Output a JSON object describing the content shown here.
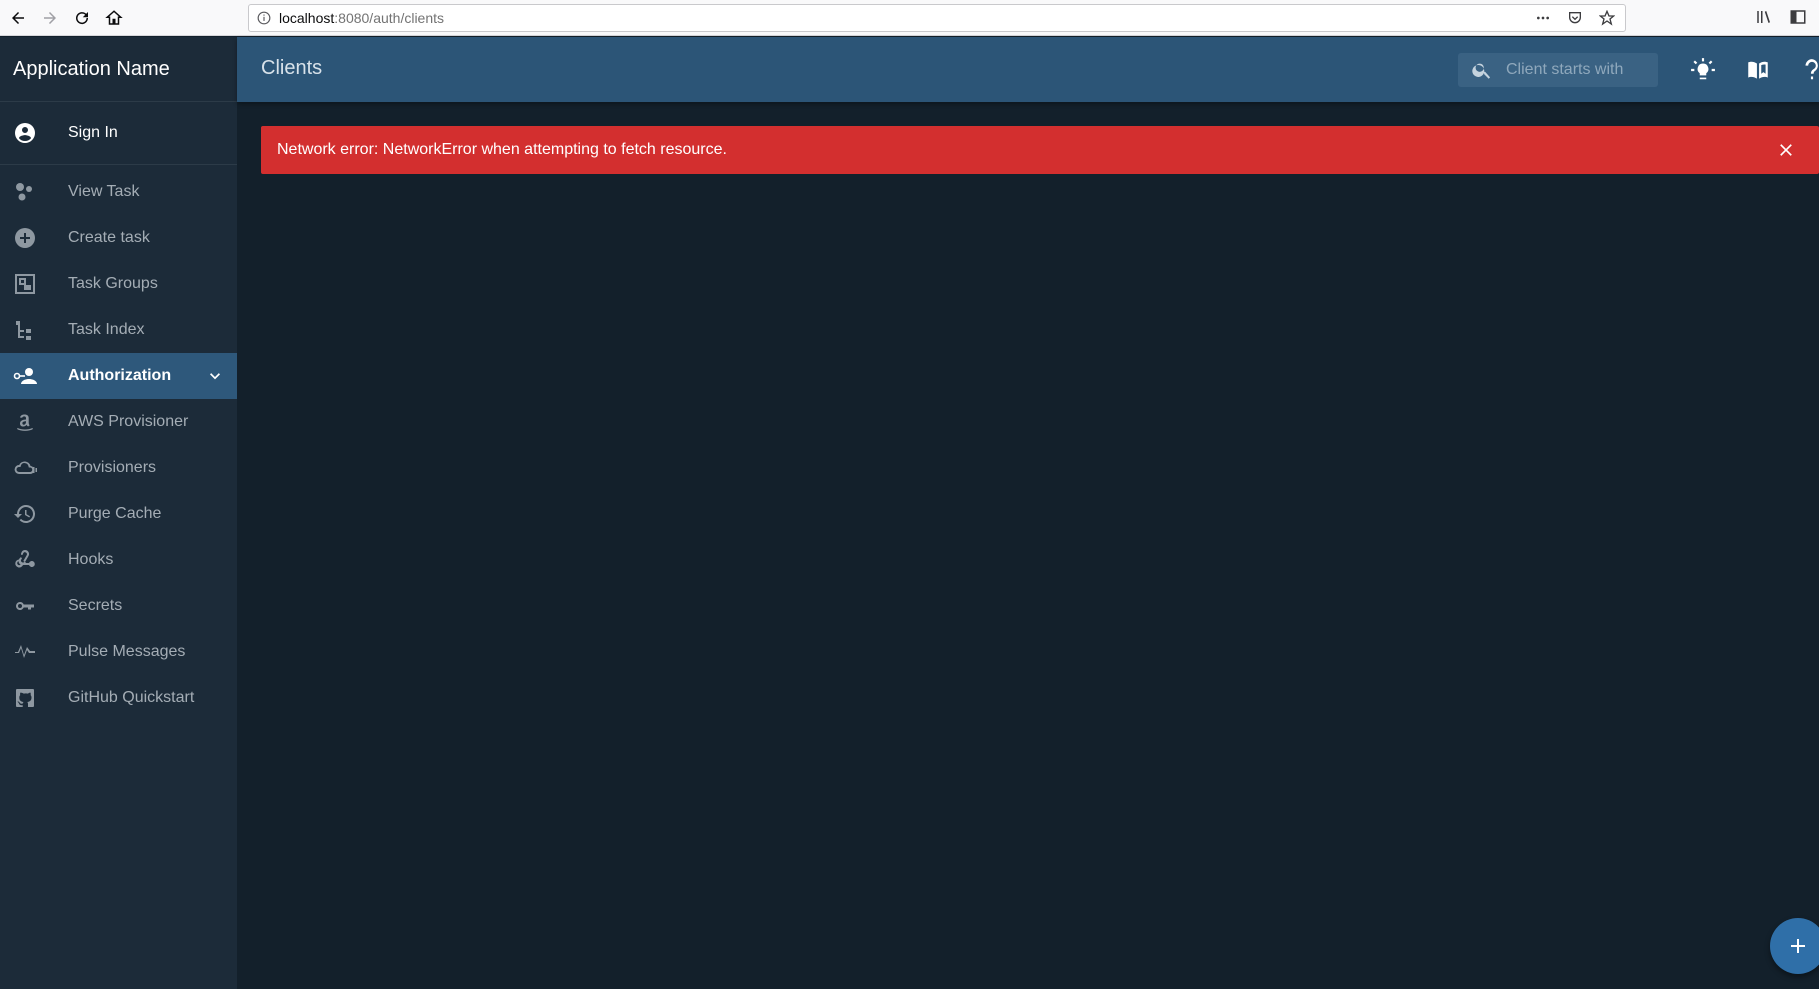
{
  "browser": {
    "url_host": "localhost",
    "url_rest": ":8080/auth/clients"
  },
  "sidebar": {
    "app_name": "Application Name",
    "sign_in": {
      "label": "Sign In",
      "icon": "account-circle-icon"
    },
    "items": [
      {
        "label": "View Task",
        "icon": "task-view-icon"
      },
      {
        "label": "Create task",
        "icon": "plus-circle-icon"
      },
      {
        "label": "Task Groups",
        "icon": "task-groups-icon"
      },
      {
        "label": "Task Index",
        "icon": "file-tree-icon"
      },
      {
        "label": "Authorization",
        "icon": "account-key-icon",
        "active": true
      },
      {
        "label": "AWS Provisioner",
        "icon": "amazon-icon"
      },
      {
        "label": "Provisioners",
        "icon": "cloud-icon"
      },
      {
        "label": "Purge Cache",
        "icon": "history-icon"
      },
      {
        "label": "Hooks",
        "icon": "webhook-icon"
      },
      {
        "label": "Secrets",
        "icon": "key-icon"
      },
      {
        "label": "Pulse Messages",
        "icon": "pulse-icon"
      },
      {
        "label": "GitHub Quickstart",
        "icon": "github-icon"
      }
    ]
  },
  "appbar": {
    "title": "Clients",
    "search_placeholder": "Client starts with"
  },
  "error": {
    "message": "Network error: NetworkError when attempting to fetch resource."
  },
  "colors": {
    "background": "#13202b",
    "sidebar": "#1c2b39",
    "appbar": "#2c5577",
    "active_item": "#2e587b",
    "error": "#d32f2f",
    "fab": "#2f6fa8"
  }
}
